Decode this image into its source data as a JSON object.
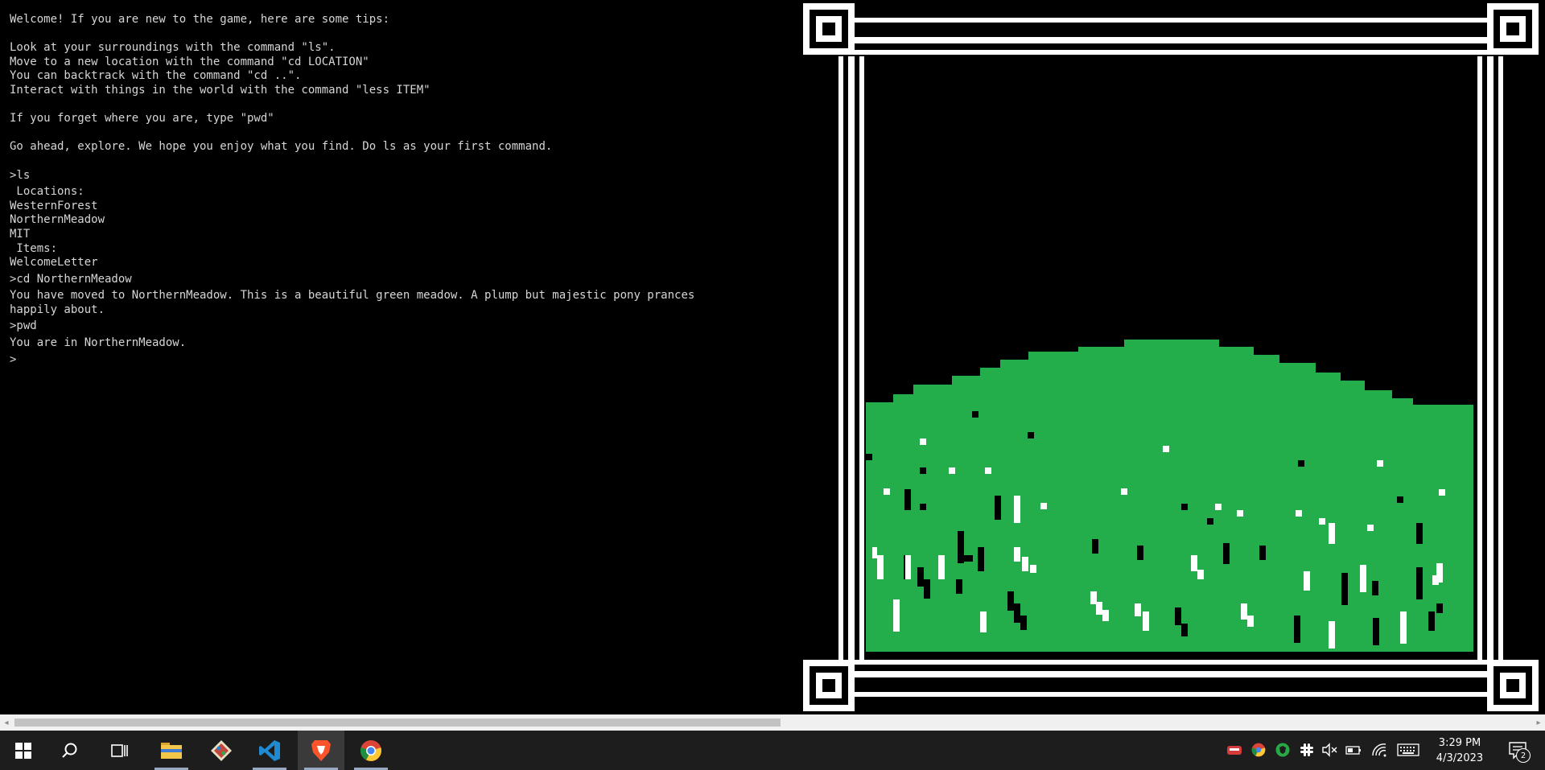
{
  "terminal": {
    "lines": {
      "welcome": "Welcome! If you are new to the game, here are some tips:",
      "tip_ls": "Look at your surroundings with the command \"ls\".",
      "tip_cd": "Move to a new location with the command \"cd LOCATION\"",
      "tip_back": "You can backtrack with the command \"cd ..\".",
      "tip_less": "Interact with things in the world with the command \"less ITEM\"",
      "tip_pwd": "If you forget where you are, type \"pwd\"",
      "go_ahead": "Go ahead, explore. We hope you enjoy what you find. Do ls as your first command.",
      "cmd_ls": ">ls",
      "locations_header": " Locations:",
      "loc_1": "WesternForest",
      "loc_2": "NorthernMeadow",
      "loc_3": "MIT",
      "items_header": " Items:",
      "item_1": "WelcomeLetter",
      "cmd_cd": ">cd NorthernMeadow",
      "moved_1": "You have moved to NorthernMeadow. This is a beautiful green meadow. A plump but majestic pony prances",
      "moved_2": "happily about.",
      "cmd_pwd": ">pwd",
      "pwd_result": "You are in NorthernMeadow.",
      "prompt": ">"
    }
  },
  "scene": {
    "meadow_color": "#23ae4b",
    "frame_color": "#ffffff",
    "background_color": "#000000"
  },
  "scrollbar": {
    "left_arrow": "◂",
    "right_arrow": "▸"
  },
  "taskbar": {
    "apps": [
      {
        "name": "file-explorer",
        "icon": "folder-icon"
      },
      {
        "name": "git-gui",
        "icon": "git-diamond-icon"
      },
      {
        "name": "vscode",
        "icon": "vscode-icon"
      },
      {
        "name": "brave",
        "icon": "brave-lion-icon",
        "active": true
      },
      {
        "name": "chrome",
        "icon": "chrome-icon"
      }
    ],
    "tray": [
      "teams-icon",
      "chrome-icon",
      "shield-icon",
      "slack-icon",
      "speaker-muted-icon",
      "battery-icon",
      "wifi-icon",
      "keyboard-icon"
    ],
    "clock": {
      "time": "3:29 PM",
      "date": "4/3/2023"
    },
    "notification_count": "2"
  }
}
